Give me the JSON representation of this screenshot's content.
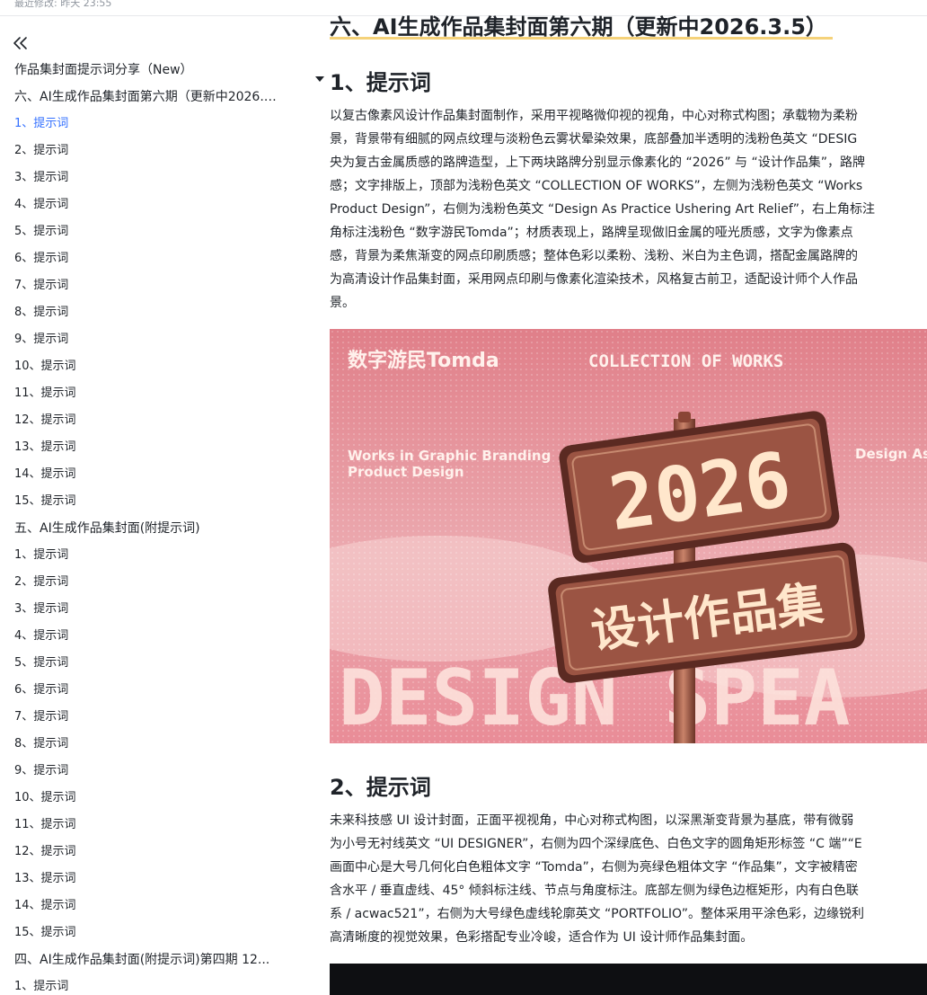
{
  "topbar": {
    "last_modified": "最近修改: 昨天 23:55"
  },
  "sidebar": {
    "collapse_label": "«",
    "items": [
      {
        "label": "作品集封面提示词分享（New）",
        "level": 1,
        "active": false
      },
      {
        "label": "六、AI生成作品集封面第六期（更新中2026.3.5）",
        "level": 1,
        "active": false
      },
      {
        "label": "1、提示词",
        "level": 2,
        "active": true
      },
      {
        "label": "2、提示词",
        "level": 2,
        "active": false
      },
      {
        "label": "3、提示词",
        "level": 2,
        "active": false
      },
      {
        "label": "4、提示词",
        "level": 2,
        "active": false
      },
      {
        "label": "5、提示词",
        "level": 2,
        "active": false
      },
      {
        "label": "6、提示词",
        "level": 2,
        "active": false
      },
      {
        "label": "7、提示词",
        "level": 2,
        "active": false
      },
      {
        "label": "8、提示词",
        "level": 2,
        "active": false
      },
      {
        "label": "9、提示词",
        "level": 2,
        "active": false
      },
      {
        "label": "10、提示词",
        "level": 2,
        "active": false
      },
      {
        "label": "11、提示词",
        "level": 2,
        "active": false
      },
      {
        "label": "12、提示词",
        "level": 2,
        "active": false
      },
      {
        "label": "13、提示词",
        "level": 2,
        "active": false
      },
      {
        "label": "14、提示词",
        "level": 2,
        "active": false
      },
      {
        "label": "15、提示词",
        "level": 2,
        "active": false
      },
      {
        "label": "五、AI生成作品集封面(附提示词)",
        "level": 1,
        "active": false
      },
      {
        "label": "1、提示词",
        "level": 2,
        "active": false
      },
      {
        "label": "2、提示词",
        "level": 2,
        "active": false
      },
      {
        "label": "3、提示词",
        "level": 2,
        "active": false
      },
      {
        "label": "4、提示词",
        "level": 2,
        "active": false
      },
      {
        "label": "5、提示词",
        "level": 2,
        "active": false
      },
      {
        "label": "6、提示词",
        "level": 2,
        "active": false
      },
      {
        "label": "7、提示词",
        "level": 2,
        "active": false
      },
      {
        "label": "8、提示词",
        "level": 2,
        "active": false
      },
      {
        "label": "9、提示词",
        "level": 2,
        "active": false
      },
      {
        "label": "10、提示词",
        "level": 2,
        "active": false
      },
      {
        "label": "11、提示词",
        "level": 2,
        "active": false
      },
      {
        "label": "12、提示词",
        "level": 2,
        "active": false
      },
      {
        "label": "13、提示词",
        "level": 2,
        "active": false
      },
      {
        "label": "14、提示词",
        "level": 2,
        "active": false
      },
      {
        "label": "15、提示词",
        "level": 2,
        "active": false
      },
      {
        "label": "四、AI生成作品集封面(附提示词)第四期 12...",
        "level": 1,
        "active": false
      },
      {
        "label": "1、提示词",
        "level": 2,
        "active": false
      }
    ]
  },
  "content": {
    "section_title": "六、AI生成作品集封面第六期（更新中2026.3.5）",
    "h2_1": "1、提示词",
    "para1": [
      "以复古像素风设计作品集封面制作，采用平视略微仰视的视角，中心对称式构图；承载物为柔粉",
      "景，背景带有细腻的网点纹理与淡粉色云雾状晕染效果，底部叠加半透明的浅粉色英文 “DESIG",
      "央为复古金属质感的路牌造型，上下两块路牌分别显示像素化的 “2026” 与 “设计作品集”，路牌",
      "感；文字排版上，顶部为浅粉色英文 “COLLECTION OF WORKS”，左侧为浅粉色英文 “Works",
      "Product Design”，右侧为浅粉色英文 “Design As Practice Ushering Art Relief”，右上角标注",
      "角标注浅粉色 “数字游民Tomda”；材质表现上，路牌呈现做旧金属的哑光质感，文字为像素点",
      "感，背景为柔焦渐变的网点印刷质感；整体色彩以柔粉、浅粉、米白为主色调，搭配金属路牌的",
      "为高清设计作品集封面，采用网点印刷与像素化渲染技术，风格复古前卫，适配设计师个人作品",
      "景。"
    ],
    "image1": {
      "brand_text": "数字游民Tomda",
      "collection_text": "COLLECTION OF WORKS",
      "left_line1": "Works in Graphic Branding",
      "left_line2": "Product Design",
      "right_text": "Design As",
      "sign_top": "2026",
      "sign_bottom": "设计作品集",
      "bg_text": "DESIGN  SPEA"
    },
    "h2_2": "2、提示词",
    "para2": [
      "未来科技感 UI 设计封面，正面平视视角，中心对称式构图，以深黑渐变背景为基底，带有微弱",
      "为小号无衬线英文 “UI DESIGNER”，右侧为四个深绿底色、白色文字的圆角矩形标签 “C 端”“E",
      "画面中心是大号几何化白色粗体文字 “Tomda”，右侧为亮绿色粗体文字 “作品集”，文字被精密",
      "含水平 / 垂直虚线、45° 倾斜标注线、节点与角度标注。底部左侧为绿色边框矩形，内有白色联",
      "系 / acwac521”，右侧为大号绿色虚线轮廓英文 “PORTFOLIO”。整体采用平涂色彩，边缘锐利",
      "高清晰度的视觉效果，色彩搭配专业冷峻，适合作为 UI 设计师作品集封面。"
    ]
  }
}
